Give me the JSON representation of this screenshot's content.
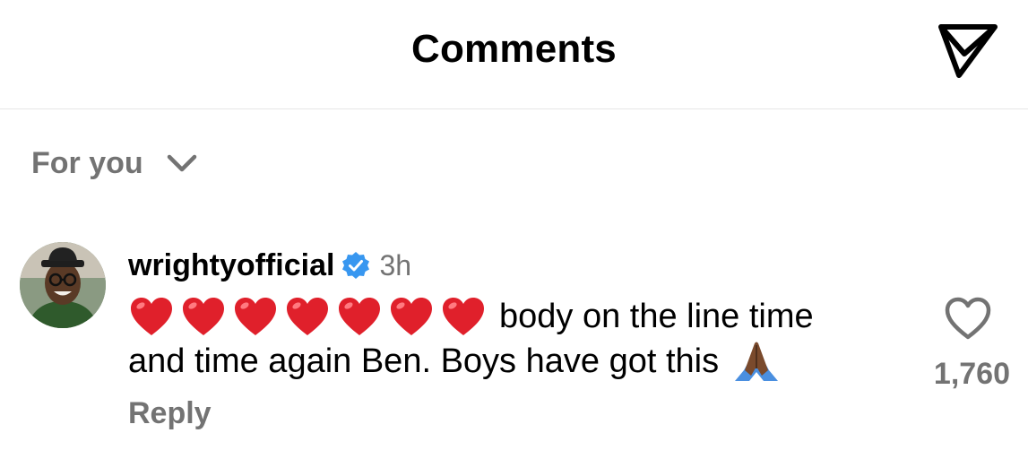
{
  "header": {
    "title": "Comments",
    "share_icon": "send-icon"
  },
  "filter": {
    "label": "For you",
    "icon": "chevron-down-icon"
  },
  "comment": {
    "avatar_icon": "profile-avatar",
    "username": "wrightyofficial",
    "verified_icon": "verified-badge-icon",
    "verified_color": "#3897f0",
    "time": "3h",
    "heart_count_emojis": 7,
    "text_line1": "body on the line time",
    "text_line2": "and time again Ben. Boys have got this",
    "trailing_emoji": "folded-hands-emoji",
    "reply_label": "Reply",
    "like_icon": "heart-outline-icon",
    "like_count": "1,760"
  },
  "colors": {
    "secondary_text": "#737373",
    "divider": "#e6e6e6",
    "heart_red": "#e0202b"
  }
}
